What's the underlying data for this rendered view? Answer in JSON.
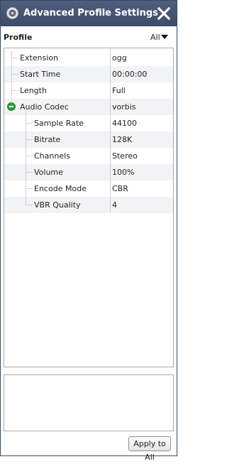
{
  "window": {
    "title": "Advanced Profile Settings",
    "icon": "speaker-icon",
    "close_icon": "close-icon"
  },
  "profile": {
    "label": "Profile",
    "filter": {
      "selected": "All",
      "icon": "chevron-down-icon"
    }
  },
  "settings": {
    "rows": [
      {
        "label": "Extension",
        "value": "ogg"
      },
      {
        "label": "Start Time",
        "value": "00:00:00"
      },
      {
        "label": "Length",
        "value": "Full"
      },
      {
        "label": "Audio Codec",
        "value": "vorbis"
      },
      {
        "label": "Sample Rate",
        "value": "44100"
      },
      {
        "label": "Bitrate",
        "value": "128K"
      },
      {
        "label": "Channels",
        "value": "Stereo"
      },
      {
        "label": "Volume",
        "value": "100%"
      },
      {
        "label": "Encode Mode",
        "value": "CBR"
      },
      {
        "label": "VBR Quality",
        "value": "4"
      }
    ]
  },
  "description": {
    "text": ""
  },
  "footer": {
    "apply_label": "Apply to All"
  },
  "colors": {
    "titlebar": "#44557a",
    "collapse_icon": "#2e9a3a"
  }
}
